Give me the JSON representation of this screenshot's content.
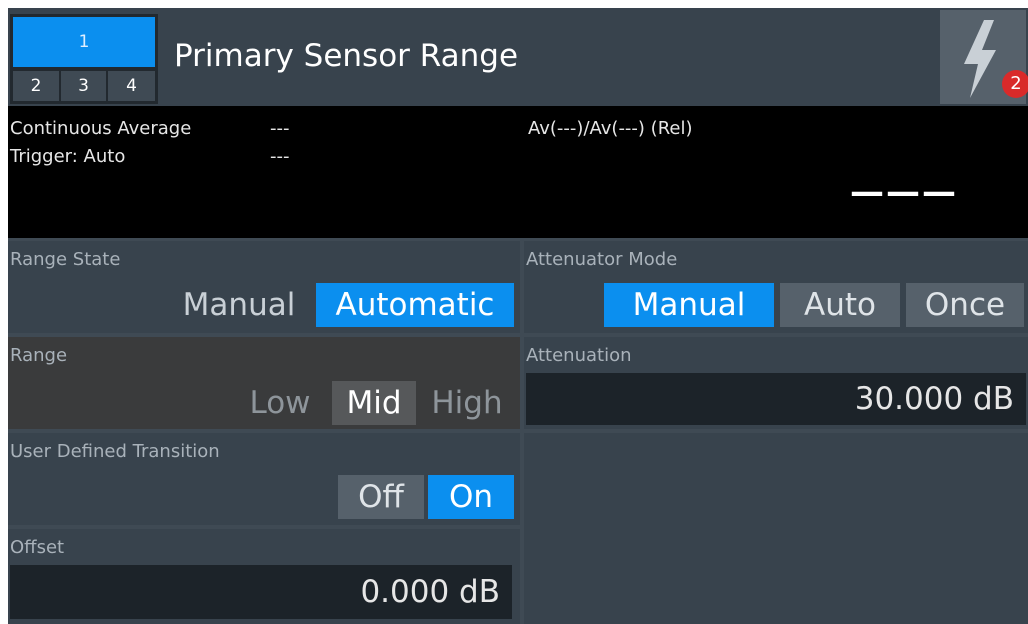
{
  "header": {
    "channels": {
      "active": "1",
      "others": [
        "2",
        "3",
        "4"
      ]
    },
    "title": "Primary Sensor Range",
    "error_count": "2"
  },
  "display": {
    "left_line1_label": "Continuous Average",
    "left_line1_value": "---",
    "left_line2_label": "Trigger: Auto",
    "left_line2_value": "---",
    "right_label": "Av(---)/Av(---) (Rel)",
    "reading": "———"
  },
  "range_state": {
    "label": "Range State",
    "options": [
      "Manual",
      "Automatic"
    ],
    "selected": "Automatic"
  },
  "range": {
    "label": "Range",
    "options": [
      "Low",
      "Mid",
      "High"
    ],
    "selected": "Mid",
    "disabled": true
  },
  "user_transition": {
    "label": "User Defined Transition",
    "options": [
      "Off",
      "On"
    ],
    "selected": "On"
  },
  "offset": {
    "label": "Offset",
    "value": "0.000 dB"
  },
  "attenuator_mode": {
    "label": "Attenuator Mode",
    "options": [
      "Manual",
      "Auto",
      "Once"
    ],
    "selected": "Manual"
  },
  "attenuation": {
    "label": "Attenuation",
    "value": "30.000 dB"
  },
  "colors": {
    "accent": "#0b8fef",
    "panel": "#38434d",
    "background": "#3f4a54",
    "error": "#d92a2a"
  }
}
